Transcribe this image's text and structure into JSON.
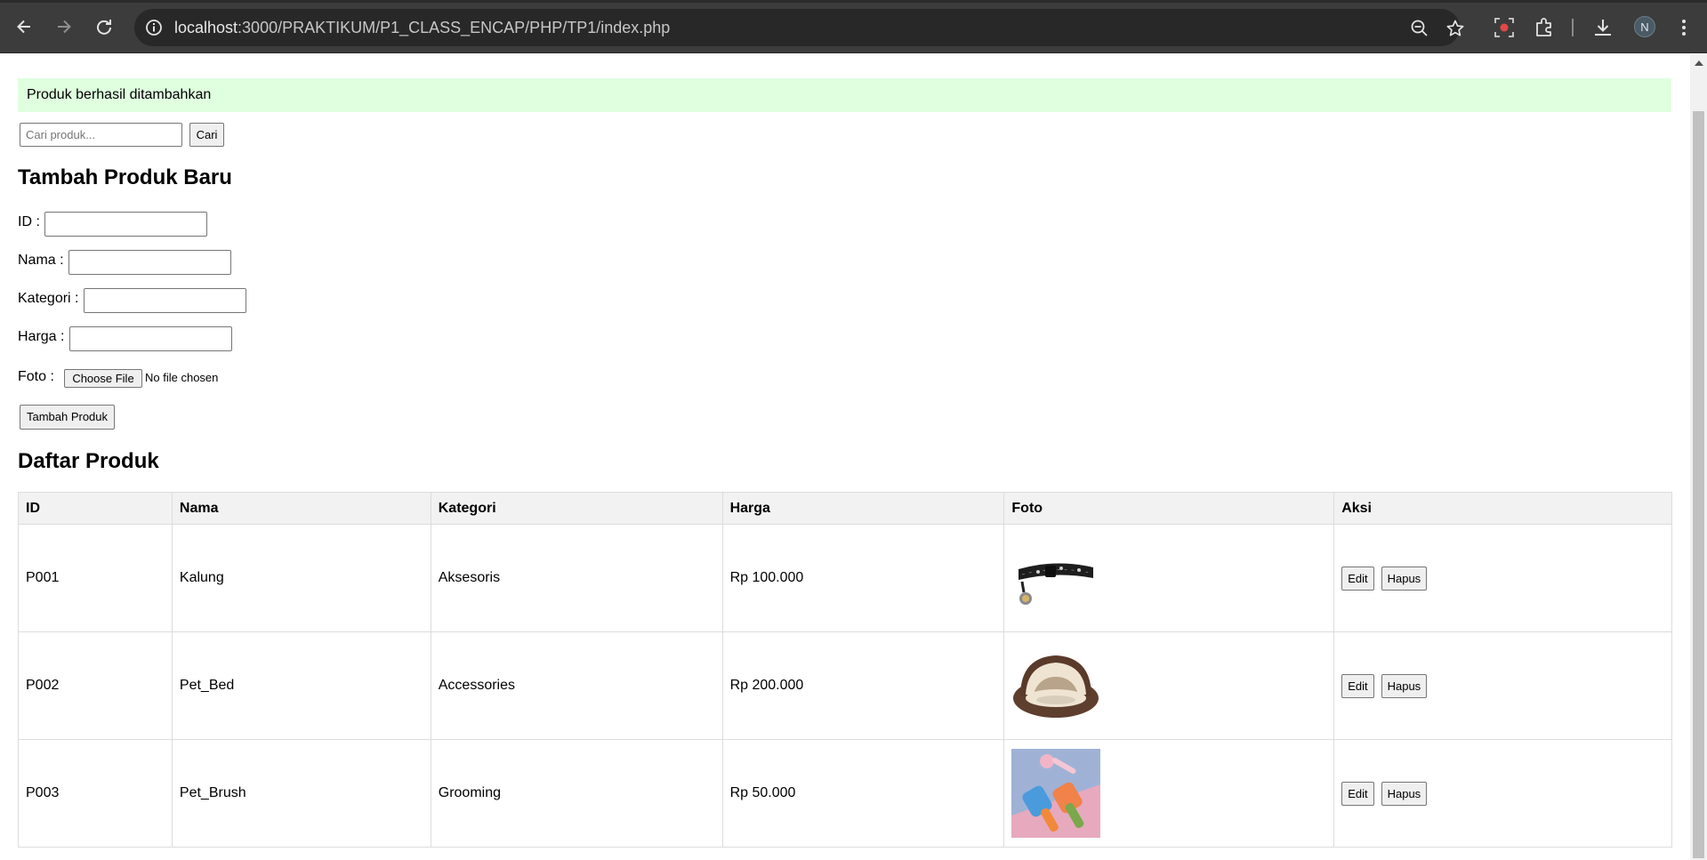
{
  "browser": {
    "url_host": "localhost",
    "url_rest": ":3000/PRAKTIKUM/P1_CLASS_ENCAP/PHP/TP1/index.php",
    "avatar_letter": "N"
  },
  "page": {
    "alert": "Produk berhasil ditambahkan",
    "search": {
      "placeholder": "Cari produk...",
      "button": "Cari"
    },
    "add_form": {
      "heading": "Tambah Produk Baru",
      "id_label": "ID :",
      "nama_label": "Nama :",
      "kategori_label": "Kategori :",
      "harga_label": "Harga :",
      "foto_label": "Foto :",
      "file_button": "Choose File",
      "file_status": "No file chosen",
      "submit": "Tambah Produk"
    },
    "list": {
      "heading": "Daftar Produk",
      "columns": [
        "ID",
        "Nama",
        "Kategori",
        "Harga",
        "Foto",
        "Aksi"
      ],
      "edit_label": "Edit",
      "delete_label": "Hapus",
      "rows": [
        {
          "id": "P001",
          "nama": "Kalung",
          "kategori": "Aksesoris",
          "harga": "Rp 100.000",
          "foto_icon": "collar-image"
        },
        {
          "id": "P002",
          "nama": "Pet_Bed",
          "kategori": "Accessories",
          "harga": "Rp 200.000",
          "foto_icon": "pet-bed-image"
        },
        {
          "id": "P003",
          "nama": "Pet_Brush",
          "kategori": "Grooming",
          "harga": "Rp 50.000",
          "foto_icon": "pet-brush-image"
        }
      ]
    }
  }
}
